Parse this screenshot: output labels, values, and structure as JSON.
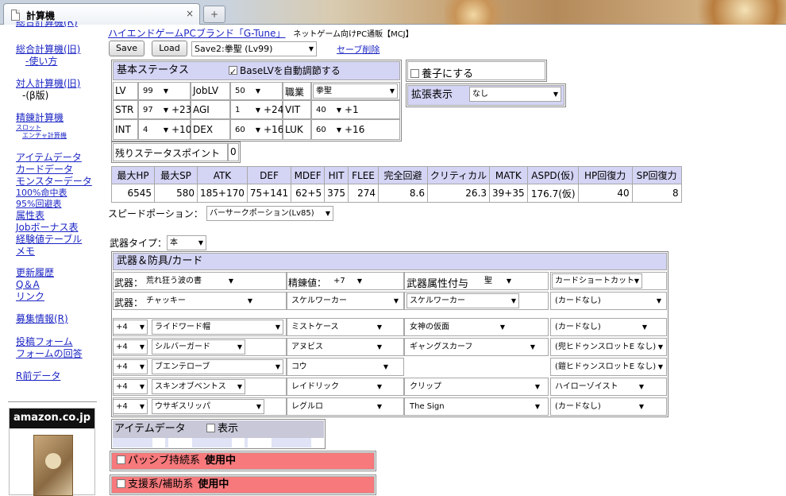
{
  "browser": {
    "tab_title": "計算機",
    "new_tab_symbol": "+"
  },
  "sidebar": {
    "links": [
      "総合計算機(旧)",
      "-使い方",
      "対人計算機(旧)",
      "精錬計算機",
      "スロット",
      "エンチャ計算機",
      "アイテムデータ",
      "カードデータ",
      "モンスターデータ",
      "100%命中表",
      "95%回避表",
      "属性表",
      "Jobボーナス表",
      "経験値テーブル",
      "メモ",
      "更新履歴",
      "Q＆A",
      "リンク",
      "募集情報(R)",
      "投稿フォーム",
      "フォームの回答",
      "R前データ"
    ],
    "cut_link": "総合計算機(R)",
    "beta_note": "-(β版)",
    "ad_logo": "amazon.co.jp"
  },
  "header": {
    "brand_link": "ハイエンドゲームPCブランド「G-Tune」",
    "brand_tail": "ネットゲーム向けPC通販【MCJ】",
    "save_button": "Save",
    "load_button": "Load",
    "save_slot": "Save2:拳聖 (Lv99)",
    "delete_link": "セーブ削除"
  },
  "basic_status": {
    "title": "基本ステータス",
    "auto_baselv_label": "BaseLVを自動調節する",
    "lv_label": "LV",
    "lv_value": "99",
    "joblv_label": "JobLV",
    "joblv_value": "50",
    "job_label": "職業",
    "job_value": "拳聖",
    "str_label": "STR",
    "str_value": "97",
    "str_bonus": "+23",
    "agi_label": "AGI",
    "agi_value": "1",
    "agi_bonus": "+24",
    "vit_label": "VIT",
    "vit_value": "40",
    "vit_bonus": "+1",
    "int_label": "INT",
    "int_value": "4",
    "int_bonus": "+10",
    "dex_label": "DEX",
    "dex_value": "60",
    "dex_bonus": "+16",
    "luk_label": "LUK",
    "luk_value": "60",
    "luk_bonus": "+16",
    "remaining_label": "残りステータスポイント",
    "remaining_value": "0"
  },
  "adopt": {
    "label": "養子にする"
  },
  "extended": {
    "label": "拡張表示",
    "value": "なし"
  },
  "stats": {
    "headers": [
      "最大HP",
      "最大SP",
      "ATK",
      "DEF",
      "MDEF",
      "HIT",
      "FLEE",
      "完全回避",
      "クリティカル",
      "MATK",
      "ASPD(仮)",
      "HP回復力",
      "SP回復力"
    ],
    "values": [
      "6545",
      "580",
      "185+170",
      "75+141",
      "62+5",
      "375",
      "274",
      "8.6",
      "26.3",
      "39+35",
      "176.7(仮)",
      "40",
      "8"
    ]
  },
  "speed_potion": {
    "label": "スピードポーション：",
    "value": "バーサークポーション(Lv85)"
  },
  "weapon_type": {
    "label": "武器タイプ：",
    "value": "本"
  },
  "equipment": {
    "title": "武器＆防具/カード",
    "weapon_label": "武器：",
    "weapon_value": "荒れ狂う波の書",
    "refine_label": "精錬値：",
    "refine_value": "+7",
    "element_label": "武器属性付与",
    "element_value": "聖",
    "card_shortcut": "カードショートカット",
    "weapon2_label": "武器：",
    "weapon2_value": "チャッキー",
    "card1": "スケルワーカー",
    "card2": "スケルワーカー",
    "card3": "(カードなし)",
    "rows": [
      {
        "refine": "+4",
        "item": "ライドワード帽",
        "card": "ミストケース",
        "extra": "女神の仮面",
        "card2": "(カードなし)"
      },
      {
        "refine": "+4",
        "item": "シルバーガード",
        "card": "アヌビス",
        "extra": "ギャングスカーフ",
        "card2": "(兜ヒドゥンスロットE なし)"
      },
      {
        "refine": "+4",
        "item": "ブエンテローブ",
        "card": "コウ",
        "extra": "",
        "card2": "(鎧ヒドゥンスロットE なし)"
      },
      {
        "refine": "+4",
        "item": "スキンオブベントス",
        "card": "レイドリック",
        "extra": "クリップ",
        "card2": "ハイローゾイスト"
      },
      {
        "refine": "+4",
        "item": "ウサギスリッパ",
        "card": "レグルロ",
        "extra": "The Sign",
        "card2": "(カードなし)"
      }
    ]
  },
  "item_data": {
    "label": "アイテムデータ",
    "show_label": "表示"
  },
  "passive": {
    "label": "パッシブ持続系",
    "status": "使用中"
  },
  "support": {
    "label": "支援系/補助系",
    "status": "使用中"
  }
}
